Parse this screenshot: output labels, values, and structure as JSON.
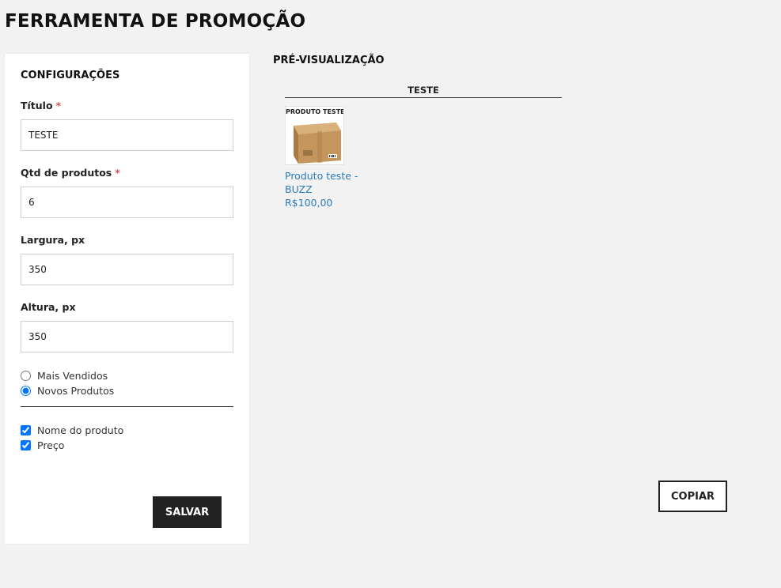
{
  "page": {
    "title": "FERRAMENTA DE PROMOÇÃO"
  },
  "config": {
    "heading": "CONFIGURAÇÕES",
    "fields": {
      "title": {
        "label": "Título",
        "required_mark": "*",
        "value": "TESTE"
      },
      "qty": {
        "label": "Qtd de produtos",
        "required_mark": "*",
        "value": "6"
      },
      "width": {
        "label": "Largura, px",
        "value": "350"
      },
      "height": {
        "label": "Altura, px",
        "value": "350"
      }
    },
    "source_options": [
      {
        "label": "Mais Vendidos",
        "selected": false
      },
      {
        "label": "Novos Produtos",
        "selected": true
      }
    ],
    "display_options": [
      {
        "label": "Nome do produto",
        "checked": true
      },
      {
        "label": "Preço",
        "checked": true
      }
    ],
    "save_label": "SALVAR"
  },
  "preview": {
    "heading": "PRÉ-VISUALIZAÇÃO",
    "widget_title": "TESTE",
    "products": [
      {
        "image_text": "PRODUTO TESTE",
        "name": "Produto teste - BUZZ",
        "price": "R$100,00"
      }
    ],
    "copy_label": "COPIAR"
  },
  "colors": {
    "background": "#f2f2f2",
    "panel": "#ffffff",
    "accent_link": "#2b7bb9",
    "button_dark": "#222222",
    "required": "#d9534f"
  }
}
